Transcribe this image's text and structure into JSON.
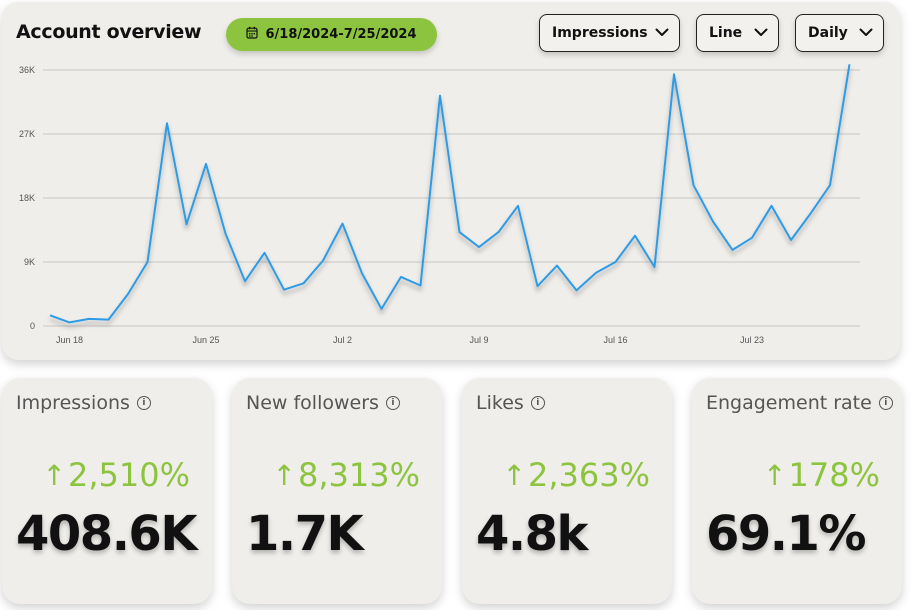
{
  "header": {
    "title": "Account overview",
    "date_range": "6/18/2024-7/25/2024",
    "metric_dropdown": "Impressions",
    "chart_type_dropdown": "Line",
    "interval_dropdown": "Daily"
  },
  "colors": {
    "accent_green": "#8cc43f",
    "line_blue": "#2f9be6",
    "panel_bg": "#f0eeea"
  },
  "chart_data": {
    "type": "line",
    "title": "",
    "xlabel": "",
    "ylabel": "",
    "ylim": [
      0,
      36000
    ],
    "yticks": [
      {
        "value": 0,
        "label": "0"
      },
      {
        "value": 9000,
        "label": "9K"
      },
      {
        "value": 18000,
        "label": "18K"
      },
      {
        "value": 27000,
        "label": "27K"
      },
      {
        "value": 36000,
        "label": "36K"
      }
    ],
    "xticks": [
      {
        "day": 1,
        "label": "Jun 18"
      },
      {
        "day": 8,
        "label": "Jun 25"
      },
      {
        "day": 15,
        "label": "Jul 2"
      },
      {
        "day": 22,
        "label": "Jul 9"
      },
      {
        "day": 29,
        "label": "Jul 16"
      },
      {
        "day": 36,
        "label": "Jul 23"
      }
    ],
    "grid": true,
    "series": [
      {
        "name": "",
        "x": [
          0,
          1,
          2,
          3,
          4,
          5,
          6,
          7,
          8,
          9,
          10,
          11,
          12,
          13,
          14,
          15,
          16,
          17,
          18,
          19,
          20,
          21,
          22,
          23,
          24,
          25,
          26,
          27,
          28,
          29,
          30,
          31,
          32,
          33,
          34,
          35,
          36,
          37,
          38,
          39,
          40,
          41
        ],
        "values": [
          1500,
          500,
          1000,
          900,
          4500,
          9000,
          28500,
          14300,
          22800,
          13000,
          6300,
          10300,
          5100,
          6000,
          9200,
          14400,
          7400,
          2400,
          6900,
          5700,
          32400,
          13200,
          11100,
          13200,
          16900,
          5600,
          8500,
          5000,
          7500,
          9000,
          12700,
          8300,
          35400,
          19800,
          14700,
          10700,
          12400,
          16900,
          12100,
          15800,
          19800,
          36800
        ]
      }
    ]
  },
  "cards": [
    {
      "label": "Impressions",
      "change": "2,510%",
      "value": "408.6K"
    },
    {
      "label": "New followers",
      "change": "8,313%",
      "value": "1.7K"
    },
    {
      "label": "Likes",
      "change": "2,363%",
      "value": "4.8k"
    },
    {
      "label": "Engagement rate",
      "change": "178%",
      "value": "69.1%"
    }
  ],
  "icons": {
    "calendar": "calendar-icon",
    "chevron": "chevron-down-icon",
    "info": "info-icon",
    "arrow_up": "arrow-up-icon"
  }
}
